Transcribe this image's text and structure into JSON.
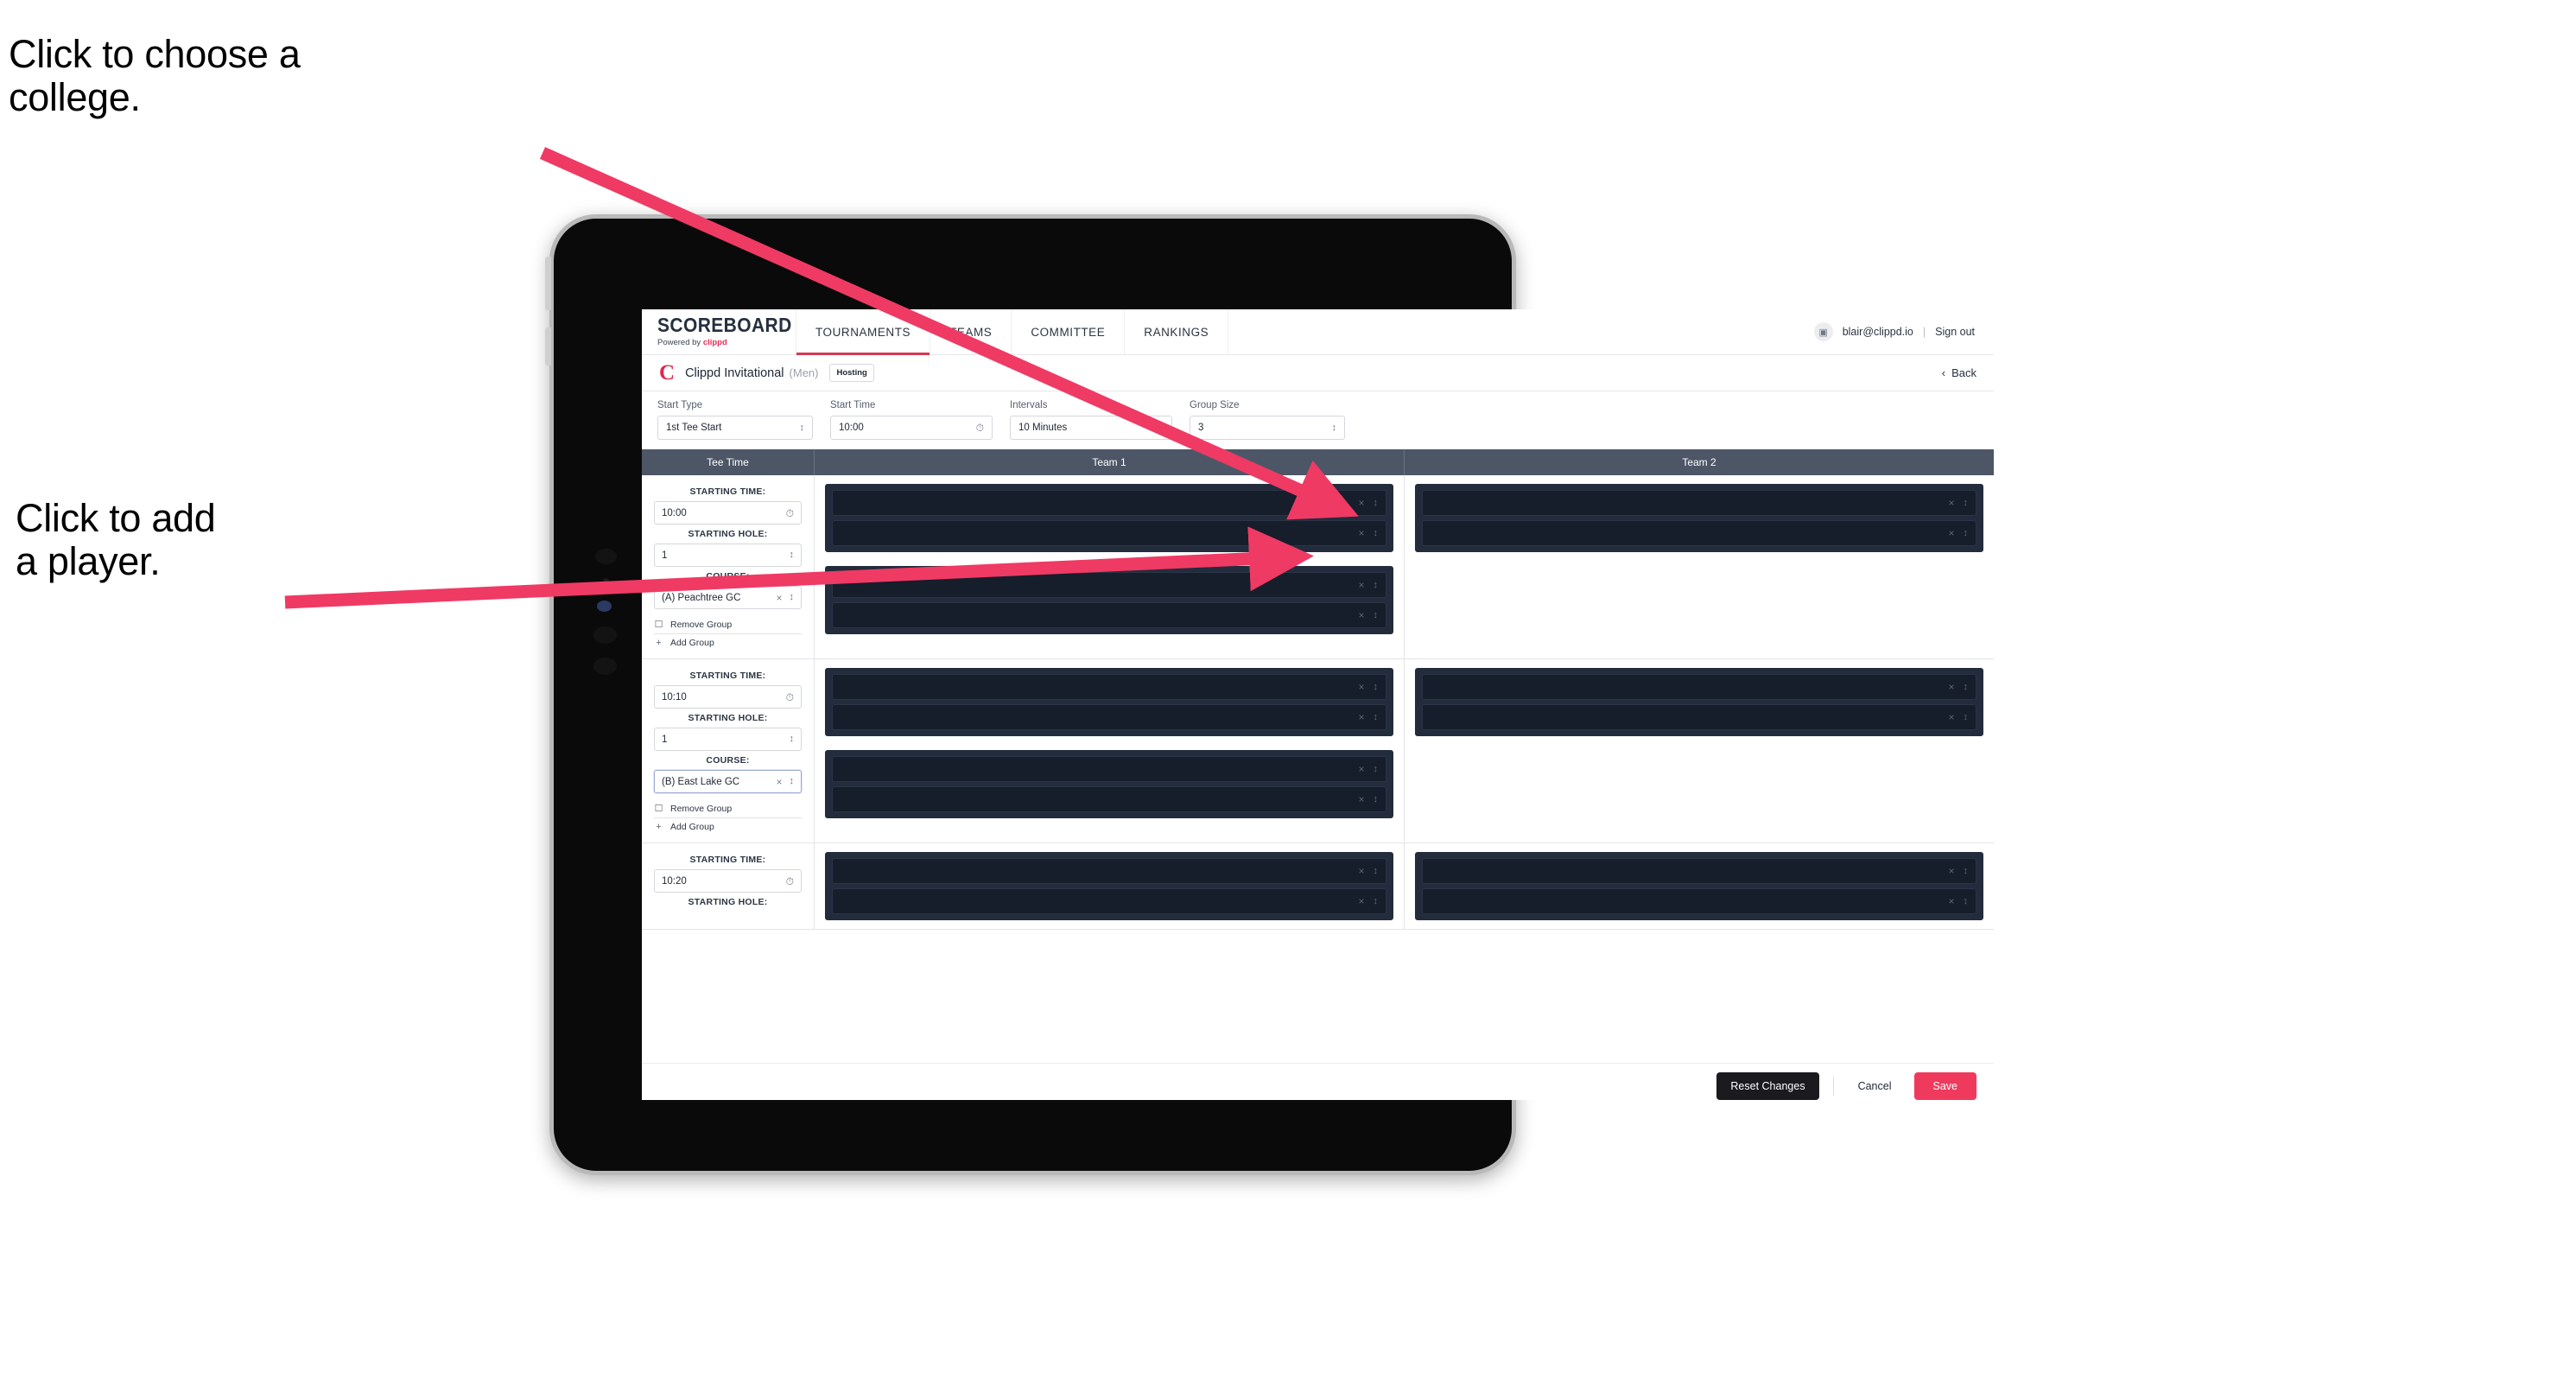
{
  "annotations": [
    {
      "id": "college",
      "text": "Click to choose a\ncollege."
    },
    {
      "id": "player",
      "text": "Click to add\na player."
    }
  ],
  "colors": {
    "accent_pink": "#ef3a5d",
    "brand_red": "#e0274e",
    "nav_underline": "#d33a53",
    "table_header": "#4d5667",
    "slot_panel": "#232c3c",
    "slot_inner": "#161d2b",
    "annotation_arrow": "#ef3a64"
  },
  "nav": {
    "logo_main": "SCOREBOARD",
    "logo_sub_prefix": "Powered by",
    "logo_sub_brand": "clippd",
    "items": [
      {
        "label": "TOURNAMENTS",
        "active": true
      },
      {
        "label": "TEAMS",
        "active": false
      },
      {
        "label": "COMMITTEE",
        "active": false
      },
      {
        "label": "RANKINGS",
        "active": false
      }
    ],
    "account_icon": "user-avatar-icon",
    "email": "blair@clippd.io",
    "separator": "|",
    "sign_out": "Sign out"
  },
  "tournament_bar": {
    "logo_letter": "C",
    "title": "Clippd Invitational",
    "gender": "(Men)",
    "badge": "Hosting",
    "back_chevron": "‹",
    "back_label": "Back"
  },
  "filters": [
    {
      "label": "Start Type",
      "value": "1st Tee Start",
      "control": "stepper"
    },
    {
      "label": "Start Time",
      "value": "10:00",
      "control": "clock"
    },
    {
      "label": "Intervals",
      "value": "10 Minutes",
      "control": "clock"
    },
    {
      "label": "Group Size",
      "value": "3",
      "control": "stepper"
    }
  ],
  "table": {
    "headers": [
      "Tee Time",
      "Team 1",
      "Team 2"
    ],
    "field_labels": {
      "starting_time": "STARTING TIME:",
      "starting_hole": "STARTING HOLE:",
      "course": "COURSE:"
    },
    "group_actions": {
      "remove": "Remove Group",
      "add": "Add Group",
      "remove_icon": "trash-icon",
      "add_icon": "plus-icon"
    },
    "slot_icons": {
      "clear": "clear-x-icon",
      "open": "chevron-updown-icon"
    },
    "rows": [
      {
        "starting_time": "10:00",
        "starting_hole": "1",
        "course": "(A) Peachtree GC",
        "course_focused": false,
        "team1_subgroups": [
          {
            "slots": [
              "",
              ""
            ]
          },
          {
            "slots": [
              "",
              ""
            ]
          }
        ],
        "team2_subgroups": [
          {
            "slots": [
              "",
              ""
            ]
          }
        ]
      },
      {
        "starting_time": "10:10",
        "starting_hole": "1",
        "course": "(B) East Lake GC",
        "course_focused": true,
        "team1_subgroups": [
          {
            "slots": [
              "",
              ""
            ]
          },
          {
            "slots": [
              "",
              ""
            ]
          }
        ],
        "team2_subgroups": [
          {
            "slots": [
              "",
              ""
            ]
          }
        ]
      },
      {
        "starting_time": "10:20",
        "starting_hole": "",
        "course": "",
        "course_focused": false,
        "partial": true,
        "team1_subgroups": [
          {
            "slots": [
              "",
              ""
            ]
          }
        ],
        "team2_subgroups": [
          {
            "slots": [
              "",
              ""
            ]
          }
        ]
      }
    ]
  },
  "footer": {
    "reset": "Reset Changes",
    "cancel": "Cancel",
    "save": "Save"
  }
}
